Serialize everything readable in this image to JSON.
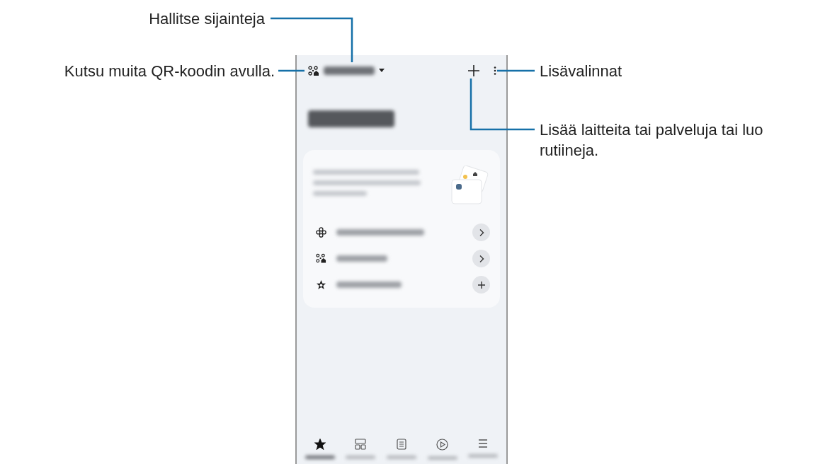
{
  "annotations": [
    {
      "text": "Hallitse sijainteja"
    },
    {
      "text": "Kutsu muita QR-koodin avulla."
    },
    {
      "text": "Lisävalinnat"
    },
    {
      "text": "Lisää laitteita tai palveluja tai luo rutiineja."
    }
  ],
  "phone": {
    "card_rows": [
      {
        "kind": "explore"
      },
      {
        "kind": "qr"
      },
      {
        "kind": "add"
      }
    ],
    "nav": [
      {
        "kind": "favourites",
        "selected": true
      },
      {
        "kind": "devices",
        "selected": false
      },
      {
        "kind": "life",
        "selected": false
      },
      {
        "kind": "routines",
        "selected": false
      },
      {
        "kind": "menu",
        "selected": false
      }
    ]
  }
}
